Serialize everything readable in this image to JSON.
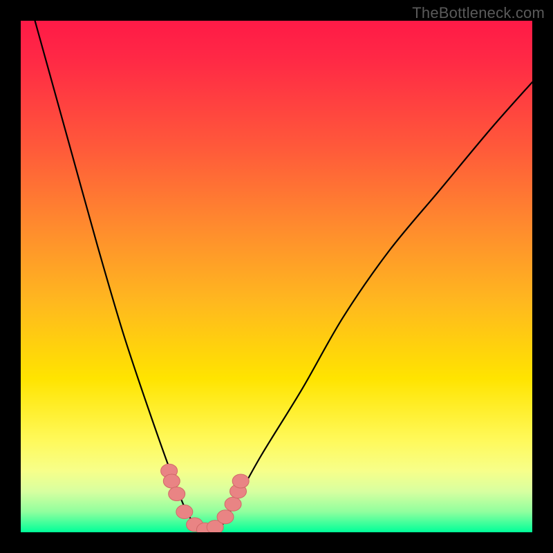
{
  "watermark": "TheBottleneck.com",
  "colors": {
    "frame": "#000000",
    "gradient_top": "#ff1a47",
    "gradient_mid": "#ffe400",
    "gradient_bottom": "#00ff99",
    "curve_stroke": "#000000",
    "marker_fill": "#e98484",
    "marker_stroke": "#d06868"
  },
  "chart_data": {
    "type": "line",
    "title": "",
    "xlabel": "",
    "ylabel": "",
    "xlim": [
      0,
      100
    ],
    "ylim": [
      0,
      100
    ],
    "note": "Values estimated from pixel positions. y represents mismatch/bottleneck magnitude (higher = worse, red zone). Curve minimum near x≈36 where y≈0 (green zone).",
    "series": [
      {
        "name": "bottleneck-curve",
        "x": [
          0,
          5,
          10,
          15,
          20,
          25,
          30,
          33,
          36,
          39,
          42,
          47,
          55,
          63,
          72,
          82,
          92,
          100
        ],
        "y": [
          110,
          92,
          74,
          56,
          39,
          24,
          10,
          3,
          0,
          1,
          6,
          15,
          28,
          42,
          55,
          67,
          79,
          88
        ]
      }
    ],
    "markers": {
      "name": "highlighted-points",
      "x": [
        29.0,
        29.5,
        30.5,
        32.0,
        34.0,
        36.0,
        38.0,
        40.0,
        41.5,
        42.5,
        43.0
      ],
      "y": [
        12.0,
        10.0,
        7.5,
        4.0,
        1.5,
        0.5,
        1.0,
        3.0,
        5.5,
        8.0,
        10.0
      ]
    }
  }
}
